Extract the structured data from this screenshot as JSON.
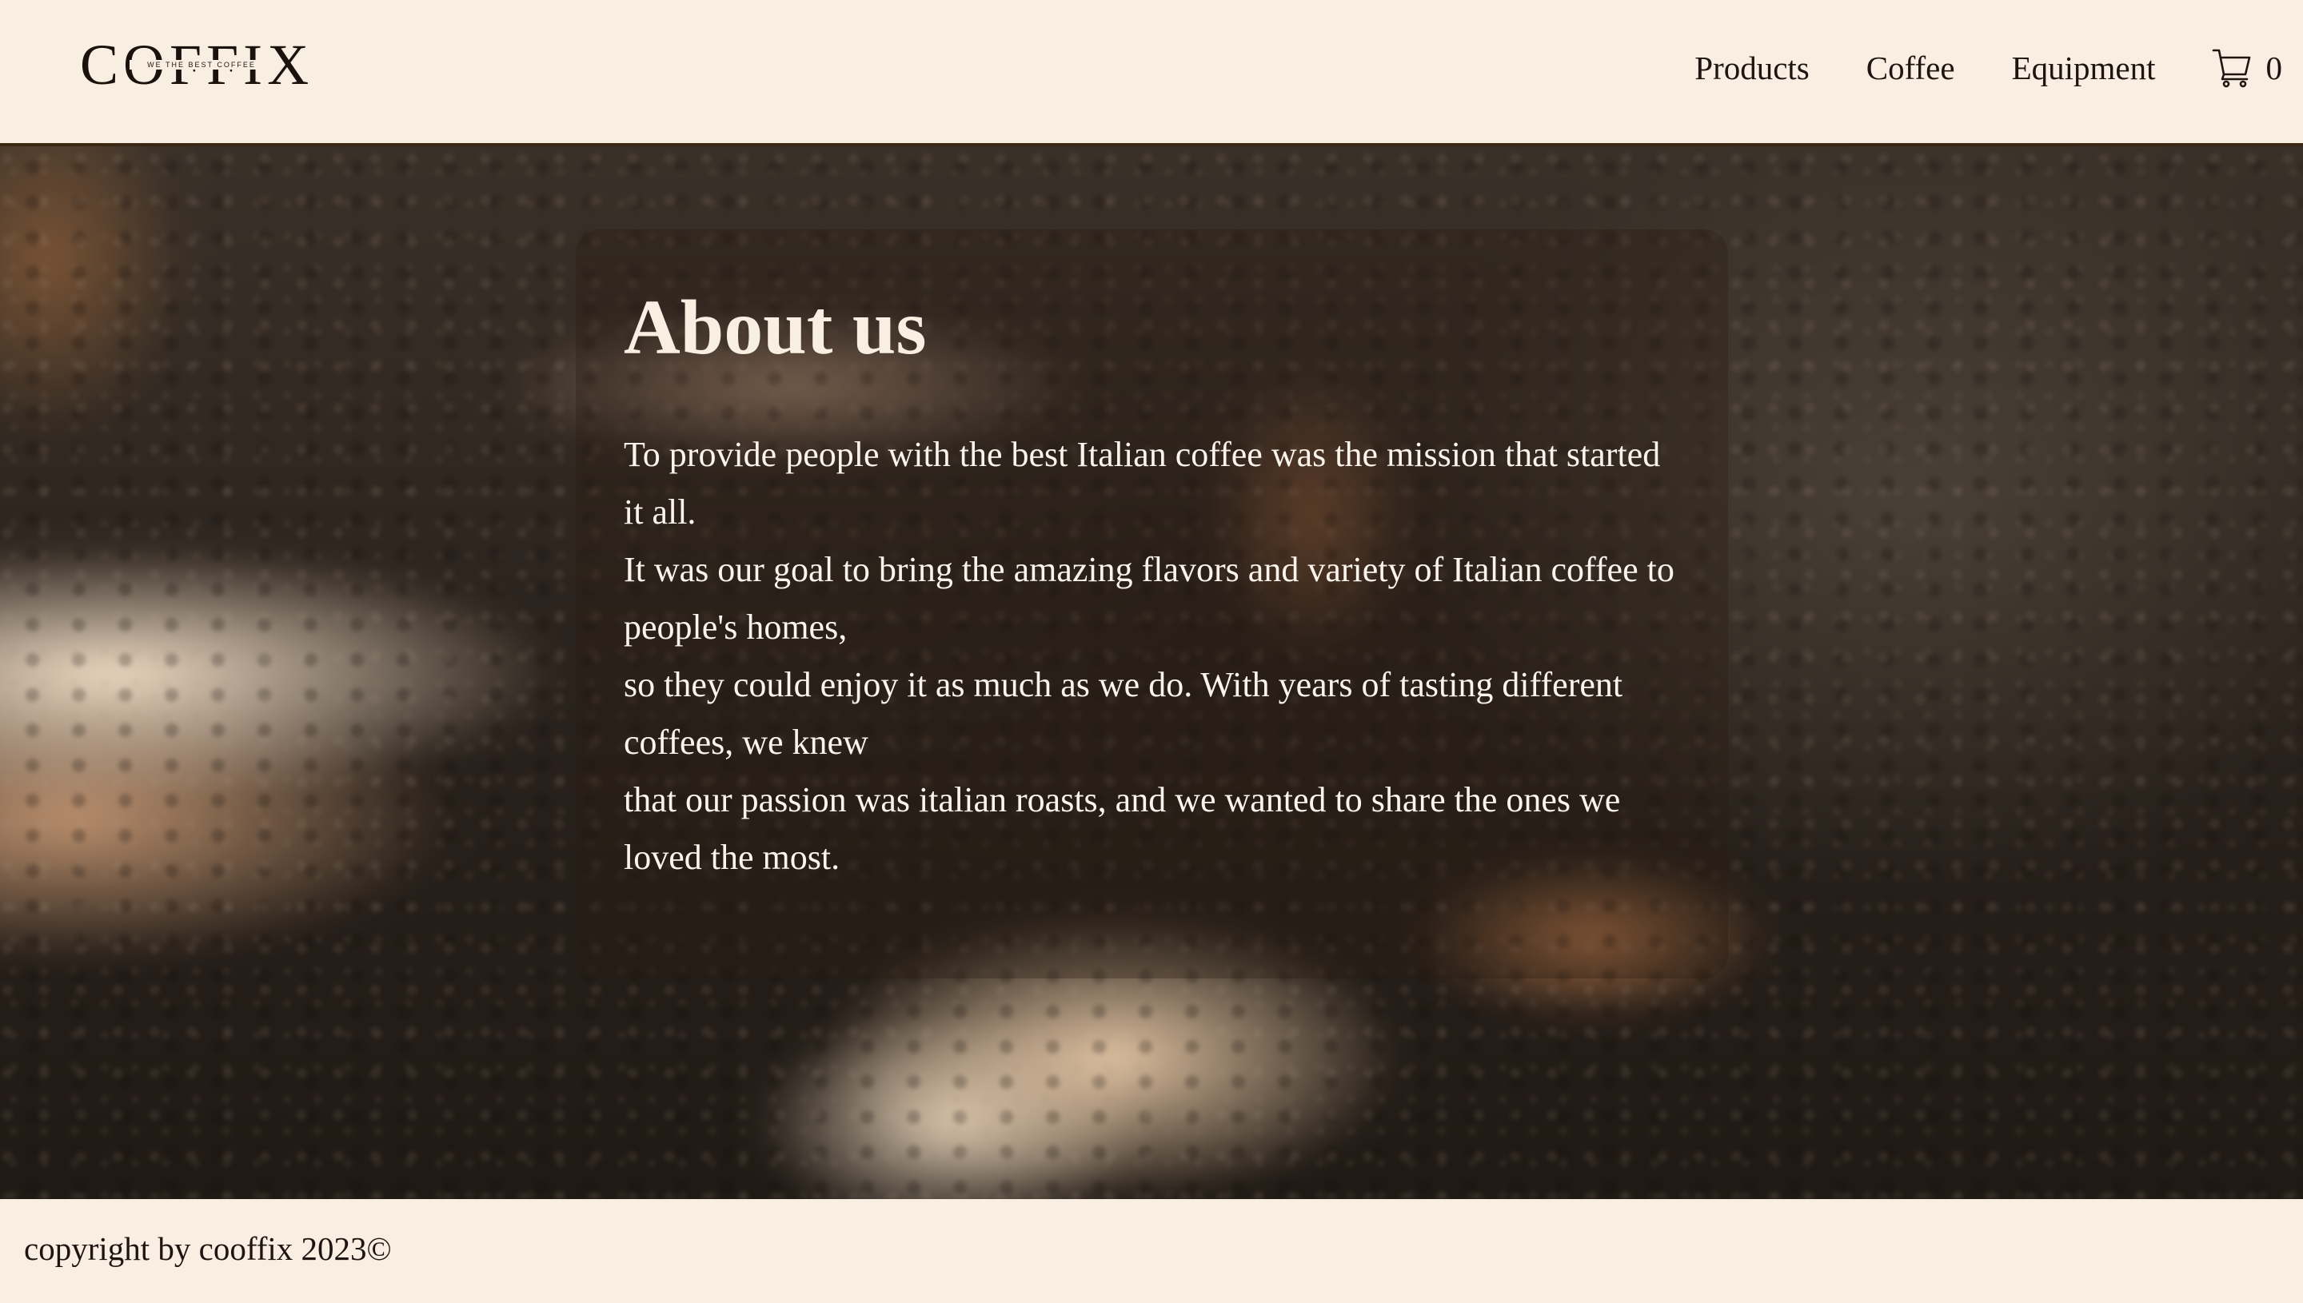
{
  "header": {
    "logo": {
      "wordmark": "COFFIX",
      "tagline": "WE THE BEST COFFEE"
    },
    "nav": [
      {
        "label": "Products"
      },
      {
        "label": "Coffee"
      },
      {
        "label": "Equipment"
      }
    ],
    "cart": {
      "icon": "cart-icon",
      "count": "0"
    }
  },
  "hero": {
    "title": "About us",
    "paragraph_lines": [
      "To provide people with the best Italian coffee was the mission that started it all.",
      "It was our goal to bring the amazing flavors and variety of Italian coffee to people's homes,",
      "so they could enjoy it as much as we do. With years of tasting different coffees, we knew",
      "that our passion was italian roasts, and we wanted to share the ones we loved the most."
    ]
  },
  "footer": {
    "copyright": "copyright by cooffix 2023©"
  },
  "colors": {
    "background": "#f8eee2",
    "text_dark": "#1e1510",
    "text_light": "#fbf4ec",
    "header_border": "#3a2714"
  }
}
